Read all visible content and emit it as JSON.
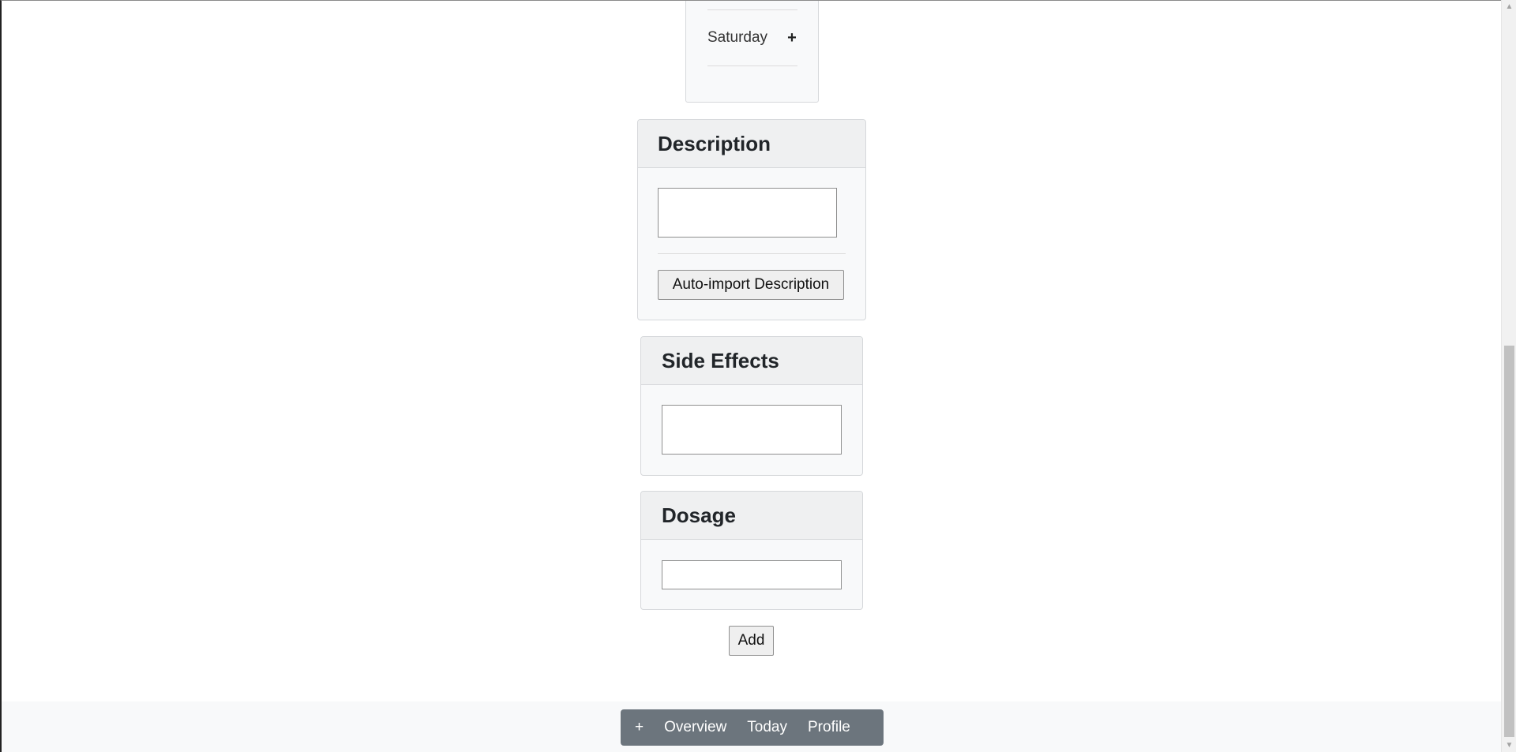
{
  "schedule": {
    "day_label": "Saturday",
    "add_symbol": "+"
  },
  "description": {
    "title": "Description",
    "value": "",
    "auto_import_label": "Auto-import Description"
  },
  "side_effects": {
    "title": "Side Effects",
    "value": ""
  },
  "dosage": {
    "title": "Dosage",
    "value": ""
  },
  "add_button_label": "Add",
  "nav": {
    "plus_label": "+",
    "overview_label": "Overview",
    "today_label": "Today",
    "profile_label": "Profile"
  },
  "scrollbar": {
    "up_arrow": "▲",
    "down_arrow": "▼"
  }
}
